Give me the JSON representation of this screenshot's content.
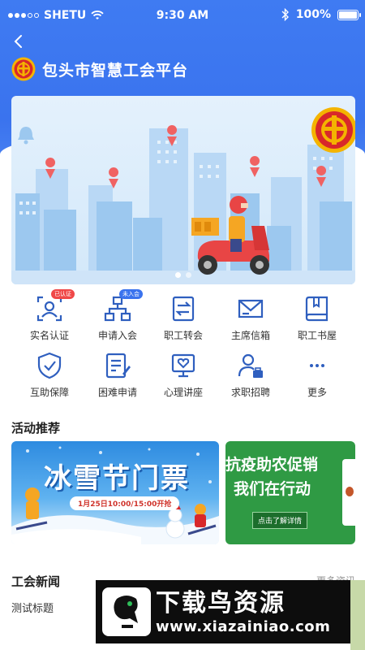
{
  "status_bar": {
    "carrier": "SHETU",
    "time": "9:30 AM",
    "battery": "100%",
    "battery_level": 1.0
  },
  "header": {
    "title": "包头市智慧工会平台"
  },
  "banner": {
    "slide_count": 2,
    "active_slide": 1
  },
  "functions": [
    {
      "label": "实名认证",
      "icon": "id-card-icon",
      "badge": "已认证",
      "badge_color": "#f04848"
    },
    {
      "label": "申请入会",
      "icon": "org-chart-icon",
      "badge": "未入会",
      "badge_color": "#3a73ee"
    },
    {
      "label": "职工转会",
      "icon": "transfer-icon"
    },
    {
      "label": "主席信箱",
      "icon": "mail-icon"
    },
    {
      "label": "职工书屋",
      "icon": "book-icon"
    },
    {
      "label": "互助保障",
      "icon": "shield-icon"
    },
    {
      "label": "困难申请",
      "icon": "form-icon"
    },
    {
      "label": "心理讲座",
      "icon": "heart-screen-icon"
    },
    {
      "label": "求职招聘",
      "icon": "job-icon"
    },
    {
      "label": "更多",
      "icon": "more-icon"
    }
  ],
  "activities": {
    "title": "活动推荐",
    "cards": [
      {
        "title": "冰雪节门票",
        "date": "1月25日10:00/15:00开抢"
      },
      {
        "line1": "抗疫助农促销",
        "line2": "我们在行动",
        "button": "点击了解详情"
      }
    ]
  },
  "news": {
    "title": "工会新闻",
    "more": "更多资讯",
    "items": [
      {
        "title": "测试标题"
      }
    ]
  },
  "watermark": {
    "brand": "下载鸟资源",
    "url": "www.xiazainiao.com"
  },
  "colors": {
    "primary": "#3a73ee",
    "icon_blue": "#2f5fbf",
    "badge_red": "#f04848"
  }
}
